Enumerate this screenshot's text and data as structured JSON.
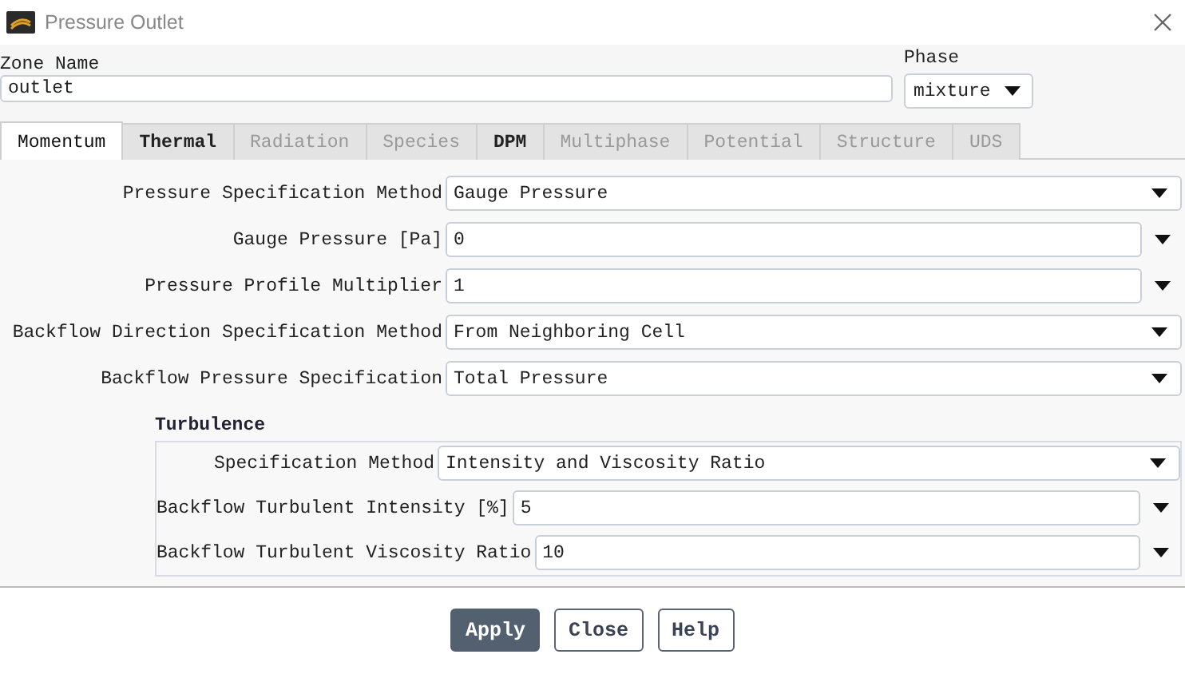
{
  "window": {
    "title": "Pressure Outlet"
  },
  "zone_name": {
    "label": "Zone Name",
    "value": "outlet"
  },
  "phase": {
    "label": "Phase",
    "value": "mixture"
  },
  "tabs": [
    {
      "label": "Momentum",
      "selected": true,
      "disabled": false
    },
    {
      "label": "Thermal",
      "selected": false,
      "disabled": false
    },
    {
      "label": "Radiation",
      "selected": false,
      "disabled": true
    },
    {
      "label": "Species",
      "selected": false,
      "disabled": true
    },
    {
      "label": "DPM",
      "selected": false,
      "disabled": false
    },
    {
      "label": "Multiphase",
      "selected": false,
      "disabled": true
    },
    {
      "label": "Potential",
      "selected": false,
      "disabled": true
    },
    {
      "label": "Structure",
      "selected": false,
      "disabled": true
    },
    {
      "label": "UDS",
      "selected": false,
      "disabled": true
    }
  ],
  "momentum": {
    "rows": [
      {
        "kind": "dropdown",
        "label": "Pressure Specification Method",
        "value": "Gauge Pressure"
      },
      {
        "kind": "number",
        "label": "Gauge Pressure [Pa]",
        "value": "0"
      },
      {
        "kind": "number",
        "label": "Pressure Profile Multiplier",
        "value": "1"
      },
      {
        "kind": "dropdown",
        "label": "Backflow Direction Specification Method",
        "value": "From Neighboring Cell"
      },
      {
        "kind": "dropdown",
        "label": "Backflow Pressure Specification",
        "value": "Total Pressure"
      }
    ],
    "turbulence": {
      "title": "Turbulence",
      "rows": [
        {
          "kind": "dropdown",
          "label": "Specification Method",
          "value": "Intensity and Viscosity Ratio"
        },
        {
          "kind": "number",
          "label": "Backflow Turbulent Intensity [%]",
          "value": "5"
        },
        {
          "kind": "number",
          "label": "Backflow Turbulent Viscosity Ratio",
          "value": "10"
        }
      ]
    }
  },
  "buttons": [
    {
      "label": "Apply",
      "kind": "primary"
    },
    {
      "label": "Close",
      "kind": "secondary"
    },
    {
      "label": "Help",
      "kind": "secondary"
    }
  ]
}
